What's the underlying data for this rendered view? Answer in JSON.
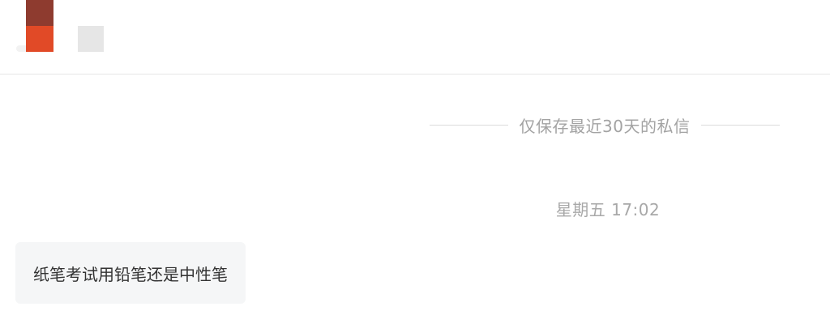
{
  "header": {
    "avatar_icon": "user-avatar",
    "avatar_colors": [
      "#8e3b2f",
      "#e14a27"
    ]
  },
  "chat": {
    "notice": "仅保存最近30天的私信",
    "timestamp": "星期五 17:02",
    "messages": [
      {
        "text": "纸笔考试用铅笔还是中性笔",
        "side": "left"
      }
    ]
  }
}
